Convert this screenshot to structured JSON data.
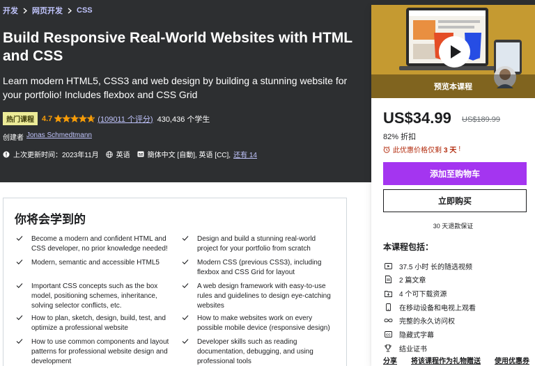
{
  "breadcrumb": [
    "开发",
    "网页开发",
    "CSS"
  ],
  "course": {
    "title": "Build Responsive Real-World Websites with HTML and CSS",
    "subtitle": "Learn modern HTML5, CSS3 and web design by building a stunning website for your portfolio! Includes flexbox and CSS Grid",
    "badge": "热门课程",
    "rating": "4.7",
    "rating_fill": 0.94,
    "ratings_count": "(109011 个评分)",
    "students": "430,436 个学生",
    "creator_label": "创建者",
    "creator_name": "Jonas Schmedtmann",
    "updated": "上次更新时间：2023年11月",
    "language": "英语",
    "captions": "簡体中文 [自動], 英语 [CC],",
    "captions_more": "还有 14"
  },
  "learn": {
    "title": "你将会学到的",
    "items": [
      "Become a modern and confident HTML and CSS developer, no prior knowledge needed!",
      "Design and build a stunning real-world project for your portfolio from scratch",
      "Modern, semantic and accessible HTML5",
      "Modern CSS (previous CSS3), including flexbox and CSS Grid for layout",
      "Important CSS concepts such as the box model, positioning schemes, inheritance, solving selector conflicts, etc.",
      "A web design framework with easy-to-use rules and guidelines to design eye-catching websites",
      "How to plan, sketch, design, build, test, and optimize a professional website",
      "How to make websites work on every possible mobile device (responsive design)",
      "How to use common components and layout patterns for professional website design and development",
      "Developer skills such as reading documentation, debugging, and using professional tools"
    ]
  },
  "sidebar": {
    "preview_label": "预览本课程",
    "price": "US$34.99",
    "original_price": "US$189.99",
    "discount": "82% 折扣",
    "timer_prefix": "此优惠价格仅剩",
    "timer_value": "3 天",
    "timer_suffix": "!",
    "add_to_cart": "添加至购物车",
    "buy_now": "立即购买",
    "guarantee": "30 天退款保证",
    "includes_title": "本课程包括：",
    "includes": [
      {
        "icon": "video-icon",
        "text": "37.5 小时 长的随选视频"
      },
      {
        "icon": "article-icon",
        "text": "2 篇文章"
      },
      {
        "icon": "download-icon",
        "text": "4 个可下载资源"
      },
      {
        "icon": "mobile-icon",
        "text": "在移动设备和电视上观看"
      },
      {
        "icon": "infinity-icon",
        "text": "完整的永久访问权"
      },
      {
        "icon": "captions-icon",
        "text": "隐藏式字幕"
      },
      {
        "icon": "trophy-icon",
        "text": "结业证书"
      }
    ],
    "footer_links": [
      "分享",
      "将该课程作为礼物赠送",
      "使用优惠券"
    ]
  },
  "colors": {
    "hero_bg": "#2d2f31",
    "accent_purple": "#a435f0",
    "link_lavender": "#c0c4fc",
    "star_orange": "#f69c08",
    "badge_bg": "#eceb98",
    "timer_red": "#b32d0f"
  }
}
